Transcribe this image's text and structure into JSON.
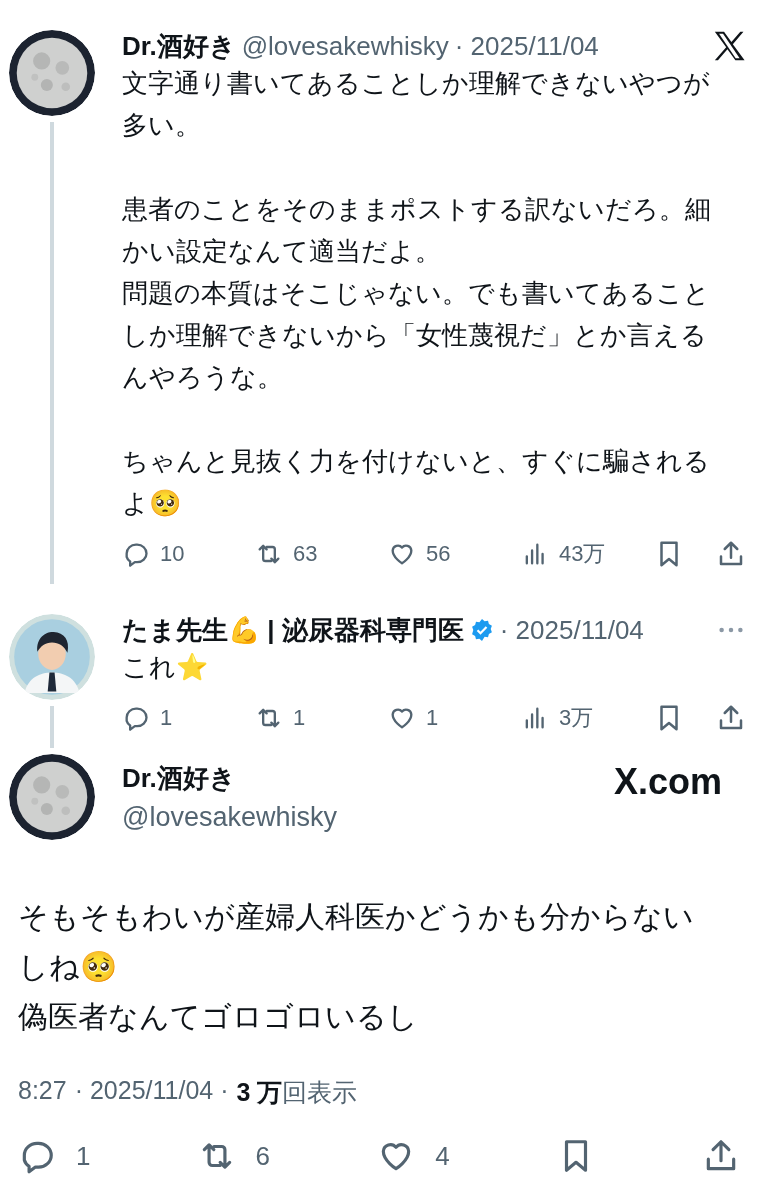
{
  "thread": [
    {
      "name": "Dr.酒好き",
      "verified": false,
      "handle": "@lovesakewhisky",
      "date": "· 2025/11/04",
      "paragraphs": [
        [
          "文字通り書いてあることしか理解できないやつが多い。"
        ],
        [
          "患者のことをそのままポストする訳ないだろ。細かい設定なんて適当だよ。",
          "問題の本質はそこじゃない。でも書いてあることしか理解できないから「女性蔑視だ」とか言えるんやろうな。"
        ],
        [
          "ちゃんと見抜く力を付けないと、すぐに騙されるよ🥺"
        ]
      ],
      "replies": "10",
      "reposts": "63",
      "likes": "56",
      "views": "43万"
    },
    {
      "name": "たま先生💪 | 泌尿器科専門医",
      "verified": true,
      "date": "· 2025/11/04",
      "paragraphs": [
        [
          "これ⭐️"
        ]
      ],
      "replies": "1",
      "reposts": "1",
      "likes": "1",
      "views": "3万"
    }
  ],
  "main": {
    "name": "Dr.酒好き",
    "handle": "@lovesakewhisky",
    "brand": "X.com",
    "text": "そもそもわいが産婦人科医かどうかも分からないしね🥺\n偽医者なんてゴロゴロいるし",
    "time": "8:27",
    "date": "· 2025/11/04 ·",
    "views": "**3 万**回表示",
    "replies": "1",
    "reposts": "6",
    "likes": "4"
  }
}
